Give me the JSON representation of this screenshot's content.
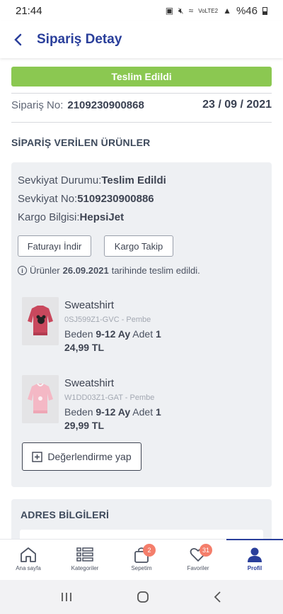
{
  "status_bar": {
    "time": "21:44",
    "network": "VoLTE2",
    "battery": "%46"
  },
  "header": {
    "title": "Sipariş Detay"
  },
  "order": {
    "status": "Teslim Edildi",
    "number_label": "Sipariş No:",
    "number": "2109230900868",
    "date": "23 / 09 / 2021"
  },
  "products_section": {
    "title": "SİPARİŞ VERİLEN ÜRÜNLER"
  },
  "shipment": {
    "status_label": "Sevkiyat Durumu:",
    "status_value": "Teslim Edildi",
    "no_label": "Sevkiyat No:",
    "no_value": "5109230900886",
    "cargo_label": "Kargo Bilgisi:",
    "cargo_value": "HepsiJet",
    "invoice_button": "Faturayı İndir",
    "track_button": "Kargo Takip",
    "note_prefix": "Ürünler",
    "note_date": "26.09.2021",
    "note_suffix": "tarihinde teslim edildi."
  },
  "products": [
    {
      "name": "Sweatshirt",
      "code": "0SJ599Z1-GVC - Pembe",
      "size_label": "Beden",
      "size": "9-12 Ay",
      "qty_label": "Adet",
      "qty": "1",
      "price": "24,99 TL",
      "color": "#c9485d"
    },
    {
      "name": "Sweatshirt",
      "code": "W1DD03Z1-GAT - Pembe",
      "size_label": "Beden",
      "size": "9-12 Ay",
      "qty_label": "Adet",
      "qty": "1",
      "price": "29,99 TL",
      "color": "#f4b8c5"
    }
  ],
  "review_button": "Değerlendirme yap",
  "address_section": {
    "title": "ADRES BİLGİLERİ"
  },
  "bottom_nav": [
    {
      "label": "Ana sayfa"
    },
    {
      "label": "Kategoriler"
    },
    {
      "label": "Sepetim",
      "badge": "2"
    },
    {
      "label": "Favoriler",
      "badge": "31"
    },
    {
      "label": "Profil"
    }
  ],
  "colors": {
    "brand": "#2a3f9b",
    "success": "#8bc851",
    "badge": "#f47e6b"
  }
}
